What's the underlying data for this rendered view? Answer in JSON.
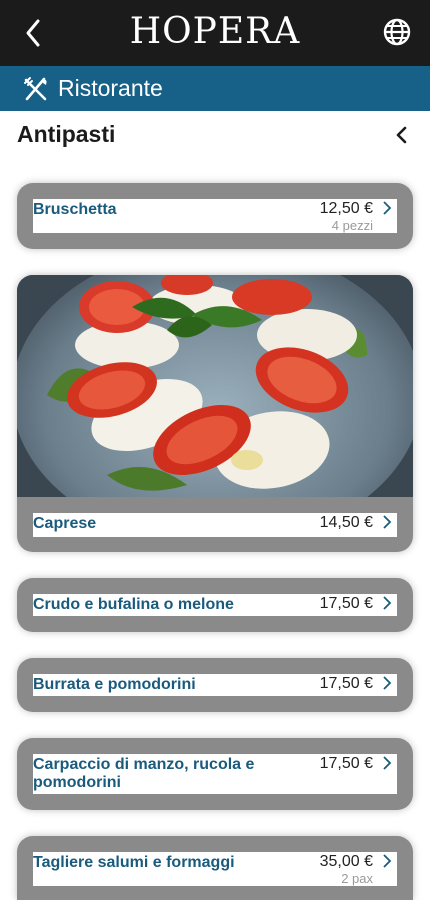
{
  "header": {
    "brand": "HOPERA"
  },
  "section": {
    "title": "Ristorante"
  },
  "category": {
    "title": "Antipasti"
  },
  "dishes": [
    {
      "name": "Bruschetta",
      "price": "12,50 €",
      "note": "4 pezzi"
    },
    {
      "name": "Caprese",
      "price": "14,50 €",
      "note": ""
    },
    {
      "name": "Crudo e bufalina o melone",
      "price": "17,50 €",
      "note": ""
    },
    {
      "name": "Burrata e pomodorini",
      "price": "17,50 €",
      "note": ""
    },
    {
      "name": "Carpaccio di manzo, rucola e pomodorini",
      "price": "17,50 €",
      "note": ""
    },
    {
      "name": "Tagliere salumi e formaggi",
      "price": "35,00 €",
      "note": "2 pax"
    }
  ],
  "colors": {
    "topbar": "#1b1b1b",
    "section_bar": "#176087",
    "dish_name": "#1a5b7d"
  },
  "icons": [
    "back-arrow-icon",
    "globe-icon",
    "cutlery-icon",
    "chevron-left-icon",
    "chevron-right-icon"
  ]
}
